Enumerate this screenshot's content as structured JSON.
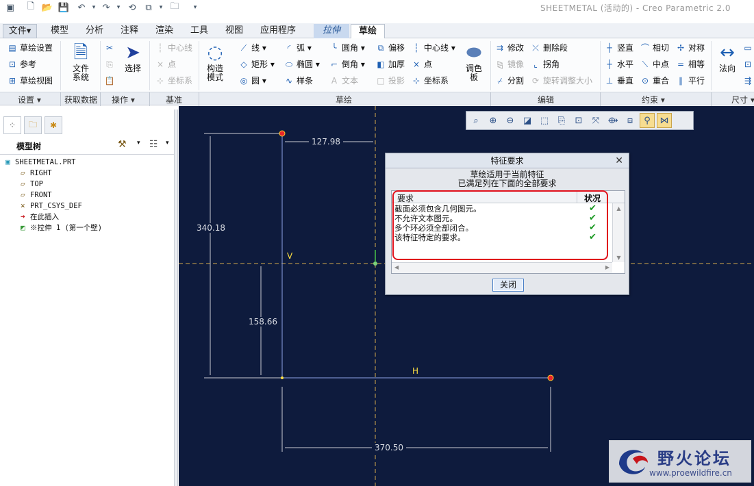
{
  "app": {
    "title": "SHEETMETAL (活动的) - Creo Parametric 2.0"
  },
  "tabs": [
    {
      "label": "文件",
      "kind": "file",
      "arrow": "▾"
    },
    {
      "label": "模型"
    },
    {
      "label": "分析"
    },
    {
      "label": "注释"
    },
    {
      "label": "渲染"
    },
    {
      "label": "工具"
    },
    {
      "label": "视图"
    },
    {
      "label": "应用程序"
    },
    {
      "label": "拉伸",
      "kind": "ctx"
    },
    {
      "label": "草绘",
      "kind": "active"
    }
  ],
  "ribbon": {
    "setup": [
      "草绘设置",
      "参考",
      "草绘视图"
    ],
    "get_data": {
      "label": "文件\n系统"
    },
    "operations": {
      "select_label": "选择"
    },
    "datum": [
      "中心线",
      "点",
      "坐标系"
    ],
    "construct_label": "构造\n模式",
    "sketch_col1": [
      "线",
      "矩形",
      "圆"
    ],
    "sketch_col2": [
      "弧",
      "椭圆",
      "样条"
    ],
    "sketch_col3": [
      "圆角",
      "倒角",
      "文本"
    ],
    "sketch_col4": [
      "偏移",
      "加厚",
      "投影"
    ],
    "sketch_col5": [
      "中心线",
      "点",
      "坐标系"
    ],
    "palette_label": "调色\n板",
    "edit_col1": [
      "修改",
      "镜像",
      "分割"
    ],
    "edit_col2": [
      "删除段",
      "拐角",
      "旋转调整大小"
    ],
    "constrain_col1": [
      "竖直",
      "水平",
      "垂直"
    ],
    "constrain_col2": [
      "相切",
      "中点",
      "重合"
    ],
    "constrain_col3": [
      "对称",
      "相等",
      "平行"
    ],
    "dimension_label": "法向"
  },
  "groups": [
    "设置 ▾",
    "获取数据",
    "操作 ▾",
    "基准",
    "草绘",
    "编辑",
    "约束 ▾",
    "尺寸 ▾"
  ],
  "model_tree": {
    "header": "模型树",
    "items": [
      {
        "label": "SHEETMETAL.PRT",
        "icon": "part-icon"
      },
      {
        "label": "RIGHT",
        "icon": "datum-plane-icon"
      },
      {
        "label": "TOP",
        "icon": "datum-plane-icon"
      },
      {
        "label": "FRONT",
        "icon": "datum-plane-icon"
      },
      {
        "label": "PRT_CSYS_DEF",
        "icon": "csys-icon"
      },
      {
        "label": "在此插入",
        "icon": "insert-here-arrow-icon"
      },
      {
        "label": "※拉伸 1 (第一个壁)",
        "icon": "extrude-wall-icon"
      }
    ]
  },
  "sketch": {
    "dims": [
      "127.98",
      "340.18",
      "158.66",
      "370.50"
    ],
    "label_v": "V",
    "label_h": "H"
  },
  "dialog": {
    "title": "特征要求",
    "message_line1": "草绘适用于当前特征",
    "message_line2": "已满足列在下面的全部要求",
    "col_requirement": "要求",
    "col_status": "状况",
    "rows": [
      {
        "text": "截面必须包含几何图元。",
        "status": "✔"
      },
      {
        "text": "不允许文本图元。",
        "status": "✔"
      },
      {
        "text": "多个环必须全部闭合。",
        "status": "✔"
      },
      {
        "text": "该特征特定的要求。",
        "status": "✔"
      }
    ],
    "close_label": "关闭"
  },
  "watermark": {
    "text": "野火论坛",
    "url": "www.proewildfire.cn"
  },
  "colors": {
    "canvas": "#0e1b3d",
    "highlight": "#e0101b",
    "check": "#1d9a25"
  }
}
